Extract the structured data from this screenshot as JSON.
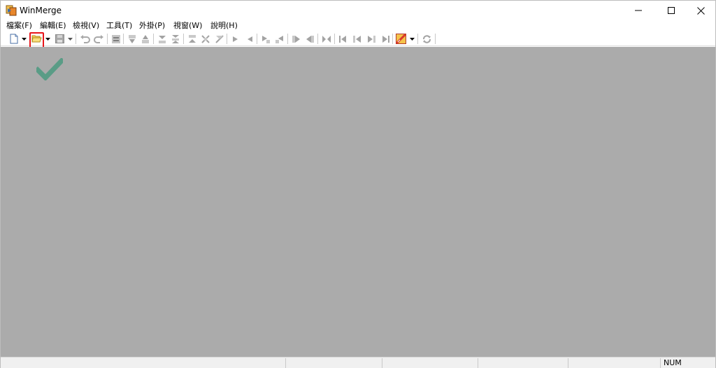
{
  "window": {
    "title": "WinMerge"
  },
  "menu": {
    "items": [
      {
        "label": "檔案(F)"
      },
      {
        "label": "編輯(E)"
      },
      {
        "label": "檢視(V)"
      },
      {
        "label": "工具(T)"
      },
      {
        "label": "外掛(P)"
      },
      {
        "label": "視窗(W)"
      },
      {
        "label": "說明(H)"
      }
    ]
  },
  "toolbar": {
    "highlighted": "open-button",
    "highlight_color": "#e8151a"
  },
  "colors": {
    "client_background": "#ababab",
    "checkmark": "#5a9c86"
  },
  "statusbar": {
    "num_indicator": "NUM"
  },
  "icons": {
    "app": "winmerge-logo-icon",
    "open": "folder-open-icon",
    "new": "new-document-icon",
    "save": "save-icon",
    "check": "checkmark-icon"
  }
}
